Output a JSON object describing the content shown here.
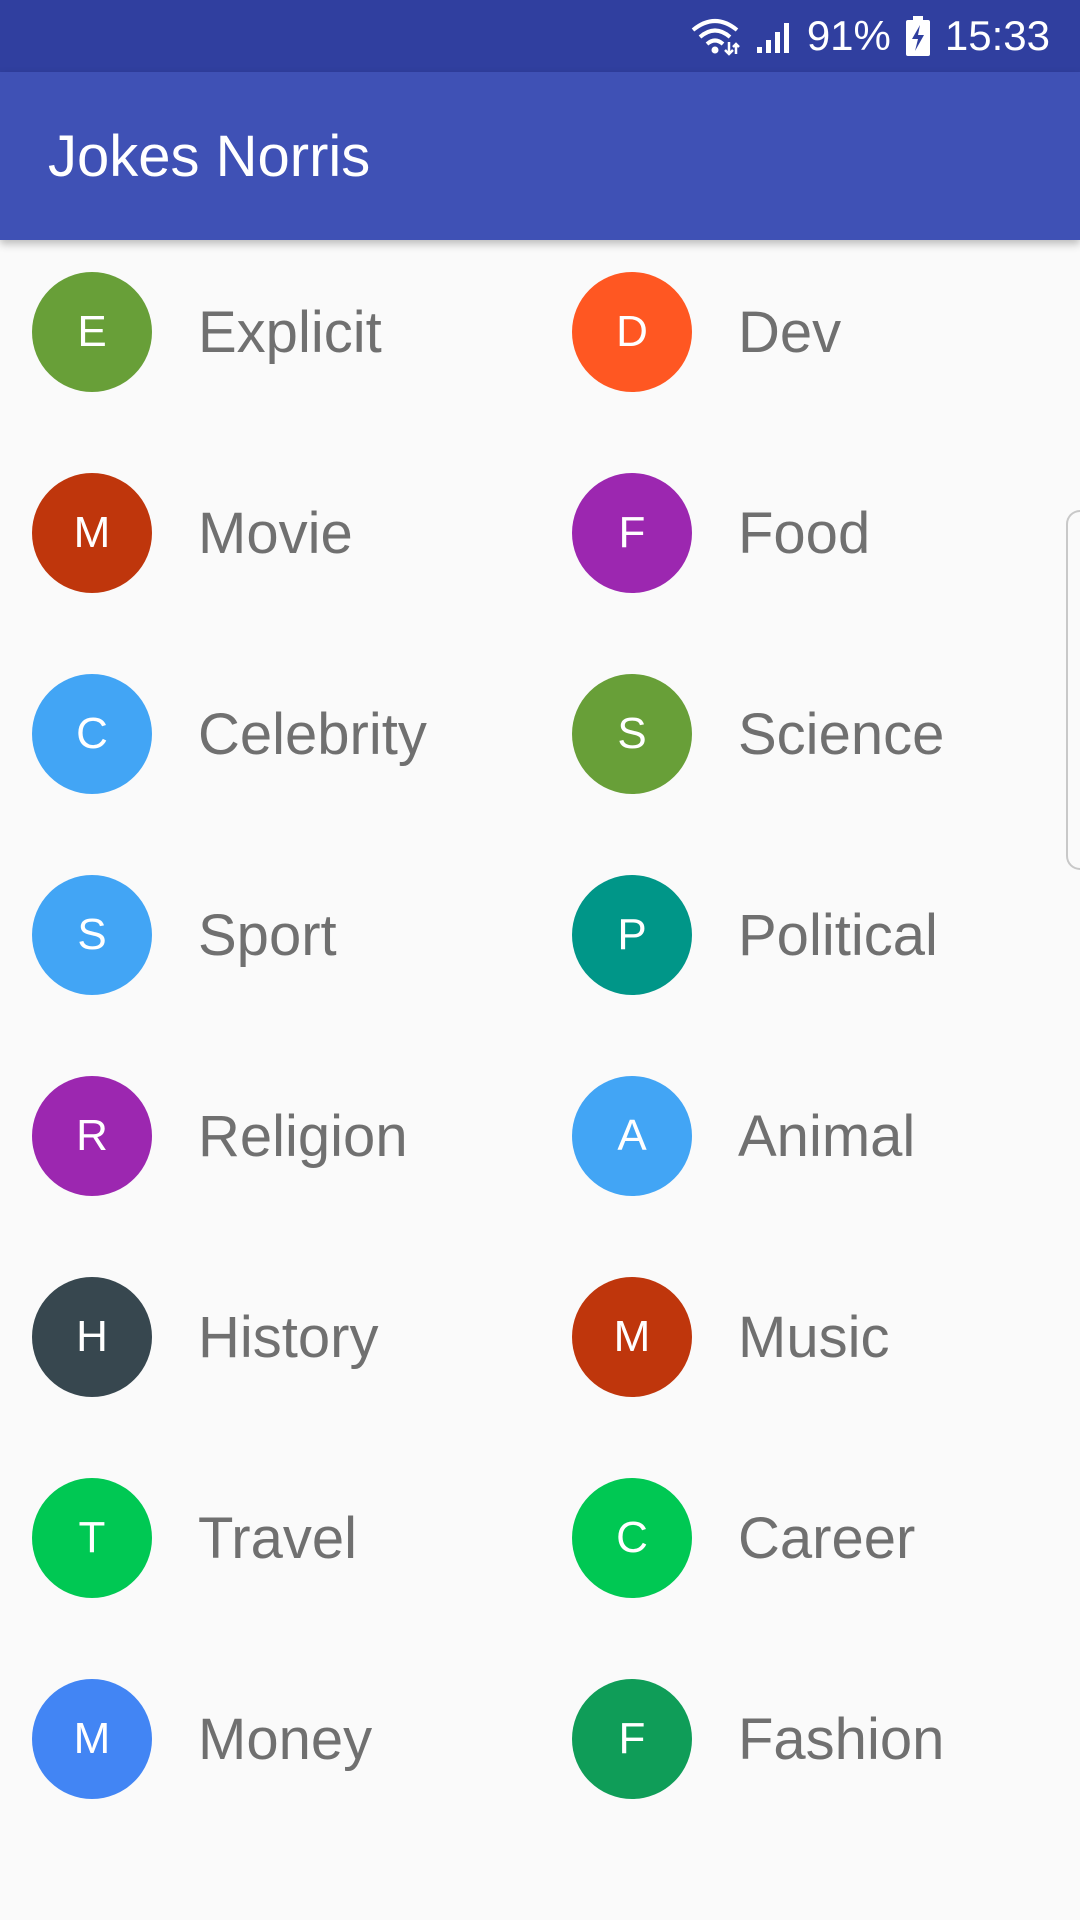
{
  "status_bar": {
    "battery": "91%",
    "time": "15:33",
    "icons": [
      "wifi-icon",
      "signal-icon",
      "battery-charging-icon"
    ]
  },
  "app_bar": {
    "title": "Jokes Norris"
  },
  "categories": [
    {
      "letter": "E",
      "label": "Explicit",
      "color": "#689f38"
    },
    {
      "letter": "D",
      "label": "Dev",
      "color": "#ff5722"
    },
    {
      "letter": "M",
      "label": "Movie",
      "color": "#bf360c"
    },
    {
      "letter": "F",
      "label": "Food",
      "color": "#9c27b0"
    },
    {
      "letter": "C",
      "label": "Celebrity",
      "color": "#42a5f5"
    },
    {
      "letter": "S",
      "label": "Science",
      "color": "#689f38"
    },
    {
      "letter": "S",
      "label": "Sport",
      "color": "#42a5f5"
    },
    {
      "letter": "P",
      "label": "Political",
      "color": "#009688"
    },
    {
      "letter": "R",
      "label": "Religion",
      "color": "#9c27b0"
    },
    {
      "letter": "A",
      "label": "Animal",
      "color": "#42a5f5"
    },
    {
      "letter": "H",
      "label": "History",
      "color": "#37474f"
    },
    {
      "letter": "M",
      "label": "Music",
      "color": "#bf360c"
    },
    {
      "letter": "T",
      "label": "Travel",
      "color": "#00c853"
    },
    {
      "letter": "C",
      "label": "Career",
      "color": "#00c853"
    },
    {
      "letter": "M",
      "label": "Money",
      "color": "#4285f4"
    },
    {
      "letter": "F",
      "label": "Fashion",
      "color": "#0f9d58"
    }
  ],
  "colors": {
    "status_bar": "#303f9f",
    "app_bar": "#3f51b5",
    "background": "#fafafa",
    "label_text": "#707070"
  }
}
